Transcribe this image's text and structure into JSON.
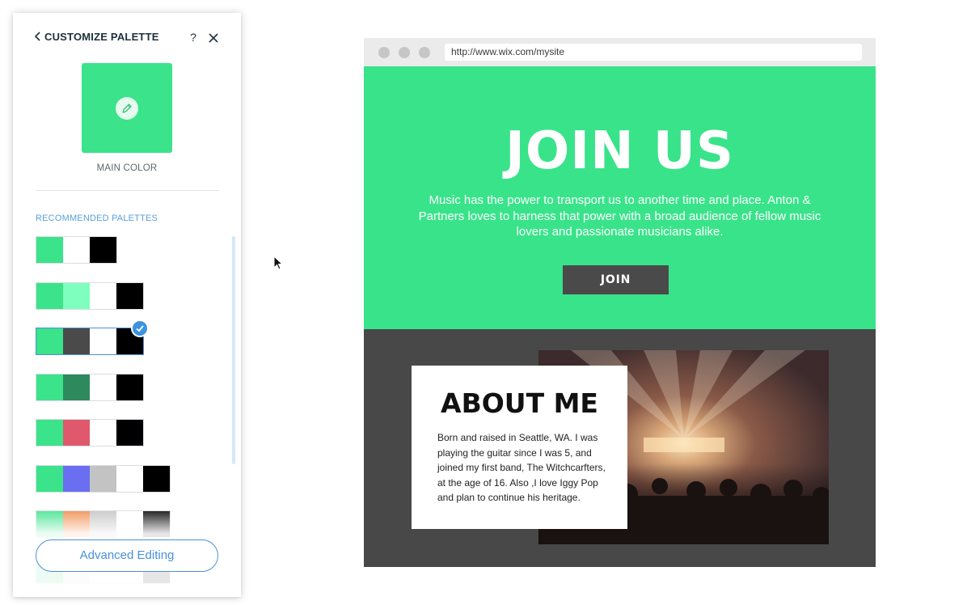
{
  "panel": {
    "title": "CUSTOMIZE PALETTE",
    "help_label": "?",
    "main_color": "#3be38a",
    "main_color_label": "MAIN COLOR",
    "recommended_label": "RECOMMENDED PALETTES",
    "advanced_button_label": "Advanced Editing",
    "accent_color": "#4a90d9",
    "palettes": [
      {
        "colors": [
          "#3be38a",
          "#ffffff",
          "#000000"
        ],
        "selected": false
      },
      {
        "colors": [
          "#3be38a",
          "#7effbd",
          "#ffffff",
          "#000000"
        ],
        "selected": false
      },
      {
        "colors": [
          "#3be38a",
          "#4a4a4a",
          "#ffffff",
          "#000000"
        ],
        "selected": true
      },
      {
        "colors": [
          "#3be38a",
          "#2e8a5c",
          "#ffffff",
          "#000000"
        ],
        "selected": false
      },
      {
        "colors": [
          "#3be38a",
          "#e0586b",
          "#ffffff",
          "#000000"
        ],
        "selected": false
      },
      {
        "colors": [
          "#3be38a",
          "#6a6ef0",
          "#c3c3c3",
          "#ffffff",
          "#000000"
        ],
        "selected": false
      },
      {
        "colors": [
          "#3be38a",
          "#f08a4a",
          "#c3c3c3",
          "#ffffff",
          "#000000"
        ],
        "selected": false
      },
      {
        "colors": [
          "#3be38a",
          "#e0e0e0",
          "#ffffff",
          "#ffffff",
          "#000000"
        ],
        "selected": false
      }
    ]
  },
  "browser": {
    "url": "http://www.wix.com/mysite",
    "hero": {
      "title": "JOIN US",
      "text": "Music has the power to transport us to another time and place. Anton & Partners loves to harness that power with a broad audience of fellow music lovers and passionate musicians alike.",
      "button_label": "JOIN",
      "background": "#39e38a"
    },
    "about": {
      "title": "ABOUT ME",
      "text": "Born and raised in Seattle, WA. I was playing the guitar since I was 5, and joined my first band, The Witchcarfters, at the age of 16. Also ,I love Iggy Pop and plan to continue his heritage.",
      "background": "#484848"
    }
  }
}
